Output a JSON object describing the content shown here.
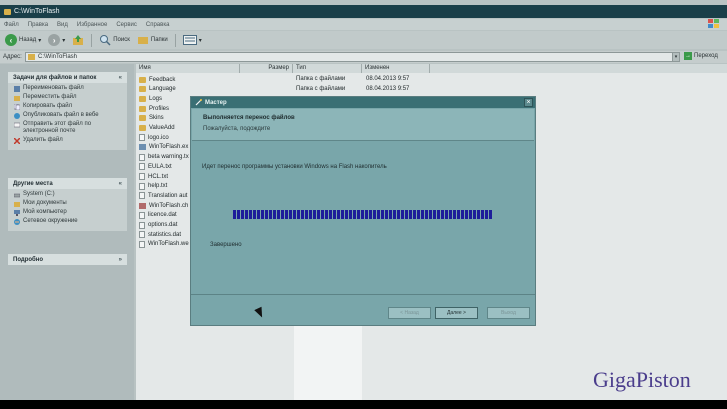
{
  "window": {
    "title": "C:\\WinToFlash"
  },
  "menu": [
    "Файл",
    "Правка",
    "Вид",
    "Избранное",
    "Сервис",
    "Справка"
  ],
  "toolbar": {
    "back": "Назад",
    "search": "Поиск",
    "folders": "Папки"
  },
  "address": {
    "label": "Адрес:",
    "value": "C:\\WinToFlash",
    "go": "Переход"
  },
  "left_pane": {
    "tasks_title": "Задачи для файлов и папок",
    "tasks": [
      {
        "label": "Переименовать файл",
        "icon": "rename-icon"
      },
      {
        "label": "Переместить файл",
        "icon": "move-icon"
      },
      {
        "label": "Копировать файл",
        "icon": "copy-icon"
      },
      {
        "label": "Опубликовать файл в вебе",
        "icon": "publish-icon"
      },
      {
        "label": "Отправить этот файл по электронной почте",
        "icon": "email-icon"
      },
      {
        "label": "Удалить файл",
        "icon": "delete-icon"
      }
    ],
    "places_title": "Другие места",
    "places": [
      {
        "label": "System (C:)",
        "icon": "drive-icon"
      },
      {
        "label": "Мои документы",
        "icon": "documents-icon"
      },
      {
        "label": "Мой компьютер",
        "icon": "computer-icon"
      },
      {
        "label": "Сетевое окружение",
        "icon": "network-icon"
      }
    ],
    "details_title": "Подробно"
  },
  "columns": {
    "name": "Имя",
    "size": "Размер",
    "type": "Тип",
    "modified": "Изменен"
  },
  "files": [
    {
      "name": "Feedback",
      "kind": "folder",
      "type": "Папка с файлами",
      "date": "08.04.2013 9:57"
    },
    {
      "name": "Language",
      "kind": "folder",
      "type": "Папка с файлами",
      "date": "08.04.2013 9:57"
    },
    {
      "name": "Logs",
      "kind": "folder",
      "type": "",
      "date": ""
    },
    {
      "name": "Profiles",
      "kind": "folder",
      "type": "",
      "date": ""
    },
    {
      "name": "Skins",
      "kind": "folder",
      "type": "",
      "date": ""
    },
    {
      "name": "ValueAdd",
      "kind": "folder",
      "type": "",
      "date": ""
    },
    {
      "name": "logo.ico",
      "kind": "doc",
      "type": "",
      "date": ""
    },
    {
      "name": "WinToFlash.ex",
      "kind": "exe",
      "type": "",
      "date": ""
    },
    {
      "name": "beta warning.tx",
      "kind": "doc",
      "type": "",
      "date": ""
    },
    {
      "name": "EULA.txt",
      "kind": "doc",
      "type": "",
      "date": ""
    },
    {
      "name": "HCL.txt",
      "kind": "doc",
      "type": "",
      "date": ""
    },
    {
      "name": "help.txt",
      "kind": "doc",
      "type": "",
      "date": ""
    },
    {
      "name": "Translation aut",
      "kind": "doc",
      "type": "",
      "date": ""
    },
    {
      "name": "WinToFlash.ch",
      "kind": "chm",
      "type": "",
      "date": ""
    },
    {
      "name": "licence.dat",
      "kind": "doc",
      "type": "",
      "date": ""
    },
    {
      "name": "options.dat",
      "kind": "doc",
      "type": "",
      "date": ""
    },
    {
      "name": "statistics.dat",
      "kind": "doc",
      "type": "",
      "date": ""
    },
    {
      "name": "WinToFlash.we",
      "kind": "doc",
      "type": "",
      "date": ""
    }
  ],
  "dialog": {
    "title": "Мастер",
    "header_title": "Выполняется перенос файлов",
    "header_subtitle": "Пожалуйста, подождите",
    "body_text": "Идет перенос программы установки Windows на Flash накопитель",
    "progress": 0.99,
    "status": "Завершено",
    "buttons": {
      "back": "< Назад",
      "next": "Далее >",
      "cancel": "Выход"
    }
  },
  "watermark": "GigaPiston",
  "colors": {
    "progress": "#1e1e9a",
    "dialog": "#79a6aa",
    "watermark": "#4a3d8c"
  }
}
